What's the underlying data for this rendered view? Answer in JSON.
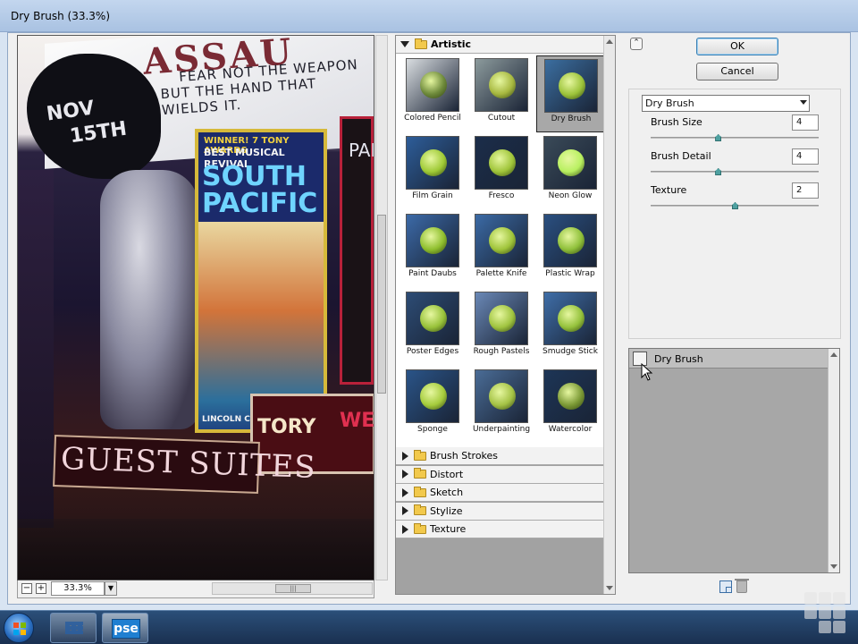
{
  "window": {
    "title": "Dry Brush (33.3%)"
  },
  "preview": {
    "zoom_value": "33.3%",
    "zoom_minus": "−",
    "zoom_plus": "+",
    "image_text": {
      "assa": "ASSAU",
      "fear": "FEAR NOT THE WEAPON",
      "fear2": "BUT THE HAND THAT WIELDS IT.",
      "nov": "NOV",
      "date": "15TH",
      "winner": "WINNER! 7 TONY AWARDS",
      "revival": "BEST MUSICAL REVIVAL",
      "south": "SOUTH",
      "pacific": "PACIFIC",
      "lincoln": "LINCOLN CENTER THEATER",
      "palace": "PALACE",
      "tory": "TORY",
      "we": "WE",
      "guest": "GUEST SUITES"
    }
  },
  "gallery": {
    "open_category": "Artistic",
    "filters": [
      {
        "label": "Colored Pencil",
        "bg": "#d9dde0",
        "apple": "#6f8b3c"
      },
      {
        "label": "Cutout",
        "bg": "#8c9a9c",
        "apple": "#a7b840"
      },
      {
        "label": "Dry Brush",
        "bg": "#3b6ea0",
        "apple": "#9cc33a",
        "selected": true
      },
      {
        "label": "Film Grain",
        "bg": "#2d5d99",
        "apple": "#9fca36"
      },
      {
        "label": "Fresco",
        "bg": "#1b2d4a",
        "apple": "#a0c53a"
      },
      {
        "label": "Neon Glow",
        "bg": "#3a4a58",
        "apple": "#b8f060"
      },
      {
        "label": "Paint Daubs",
        "bg": "#3c6aa8",
        "apple": "#8fbf2e"
      },
      {
        "label": "Palette Knife",
        "bg": "#3b6aa5",
        "apple": "#9fc43a"
      },
      {
        "label": "Plastic Wrap",
        "bg": "#2a4f80",
        "apple": "#8fc03a"
      },
      {
        "label": "Poster Edges",
        "bg": "#2d4c75",
        "apple": "#98c23a"
      },
      {
        "label": "Rough Pastels",
        "bg": "#6a88b6",
        "apple": "#a0c440"
      },
      {
        "label": "Smudge Stick",
        "bg": "#3f6ea8",
        "apple": "#95c23c"
      },
      {
        "label": "Sponge",
        "bg": "#2a5488",
        "apple": "#a5cc3c"
      },
      {
        "label": "Underpainting",
        "bg": "#4a6c96",
        "apple": "#a4c245"
      },
      {
        "label": "Watercolor",
        "bg": "#1d3556",
        "apple": "#7c9a36"
      }
    ],
    "collapsed_categories": [
      "Brush Strokes",
      "Distort",
      "Sketch",
      "Stylize",
      "Texture"
    ]
  },
  "buttons": {
    "ok": "OK",
    "cancel": "Cancel",
    "collapse": "⌃"
  },
  "settings": {
    "filter": "Dry Brush",
    "params": [
      {
        "label": "Brush Size",
        "value": "4",
        "fraction": 0.4
      },
      {
        "label": "Brush Detail",
        "value": "4",
        "fraction": 0.4
      },
      {
        "label": "Texture",
        "value": "2",
        "fraction": 0.5
      }
    ]
  },
  "effect_layers": [
    {
      "label": "Dry Brush"
    }
  ],
  "taskbar": {
    "pse_label": "pse"
  }
}
